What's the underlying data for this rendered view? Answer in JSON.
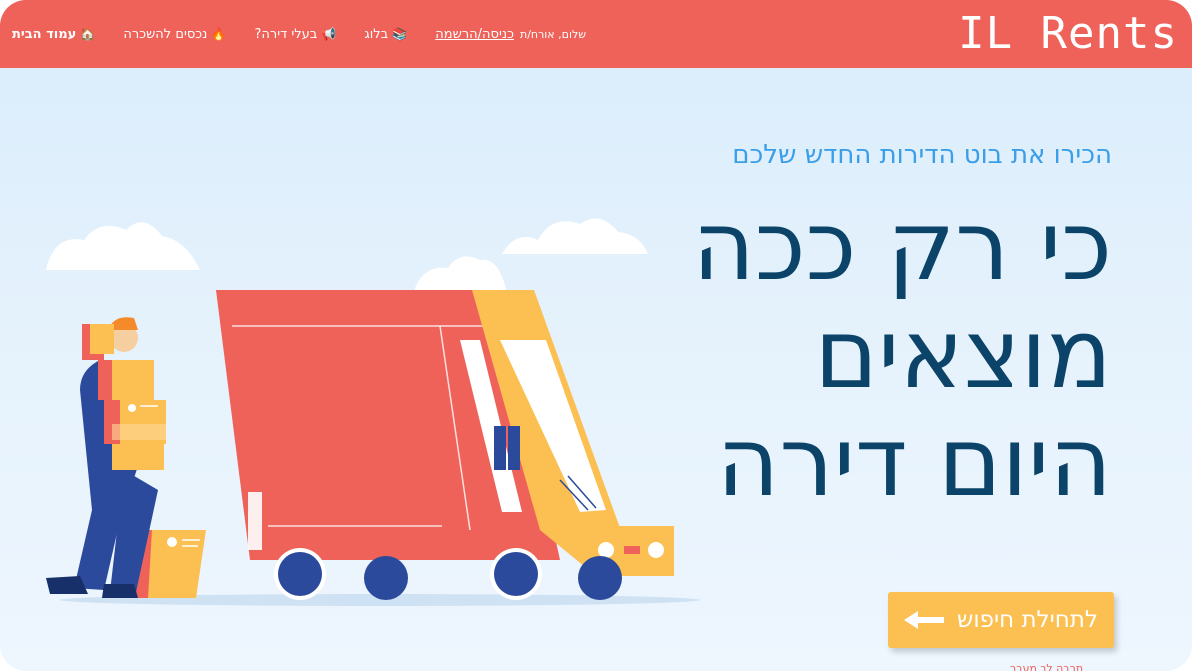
{
  "header": {
    "logo": "IL Rents",
    "nav": [
      {
        "icon": "house-icon",
        "glyph": "🏠",
        "label": "עמוד הבית",
        "active": true
      },
      {
        "icon": "fire-icon",
        "glyph": "🔥",
        "label": "נכסים להשכרה",
        "active": false
      },
      {
        "icon": "megaphone-icon",
        "glyph": "📢",
        "label": "בעלי דירה?",
        "active": false
      },
      {
        "icon": "books-icon",
        "glyph": "📚",
        "label": "בלוג",
        "active": false
      }
    ],
    "greeting": "שלום, אורח/ת",
    "login": "כניסה/הרשמה"
  },
  "hero": {
    "subtitle": "הכירו את בוט הדירות החדש שלכם",
    "headline": [
      "כי רק ככה",
      "מוצאים",
      "היום דירה"
    ],
    "cta": "לתחילת חיפוש",
    "fineprint": "תרבה לך מעבר"
  },
  "colors": {
    "brand": "#ee625a",
    "accent": "#fbbf52",
    "headline": "#0b4468",
    "subtitle": "#3a9ee8"
  }
}
